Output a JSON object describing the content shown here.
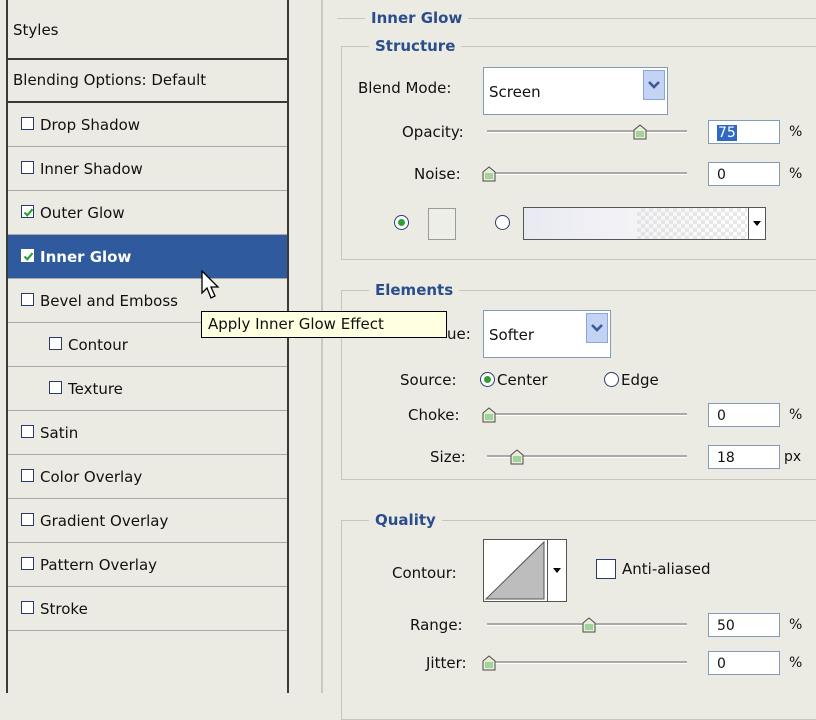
{
  "left_panel": {
    "styles_header": "Styles",
    "blending_header": "Blending Options: Default",
    "items": [
      {
        "label": "Drop Shadow",
        "checked": false
      },
      {
        "label": "Inner Shadow",
        "checked": false
      },
      {
        "label": "Outer Glow",
        "checked": true
      },
      {
        "label": "Inner Glow",
        "checked": true,
        "selected": true
      },
      {
        "label": "Bevel and Emboss",
        "checked": false
      },
      {
        "label": "Contour",
        "checked": false,
        "indent": true
      },
      {
        "label": "Texture",
        "checked": false,
        "indent": true
      },
      {
        "label": "Satin",
        "checked": false
      },
      {
        "label": "Color Overlay",
        "checked": false
      },
      {
        "label": "Gradient Overlay",
        "checked": false
      },
      {
        "label": "Pattern Overlay",
        "checked": false
      },
      {
        "label": "Stroke",
        "checked": false
      }
    ]
  },
  "tooltip": "Apply Inner Glow Effect",
  "inner_glow": {
    "title": "Inner Glow",
    "structure": {
      "title": "Structure",
      "blend_mode_label": "Blend Mode:",
      "blend_mode_value": "Screen",
      "opacity_label": "Opacity:",
      "opacity_value": "75",
      "opacity_unit": "%",
      "noise_label": "Noise:",
      "noise_value": "0",
      "noise_unit": "%",
      "color_radio_selected": "solid-color"
    },
    "elements": {
      "title": "Elements",
      "technique_label_visible": "ue:",
      "technique_value": "Softer",
      "source_label": "Source:",
      "source_center": "Center",
      "source_edge": "Edge",
      "source_selected": "Center",
      "choke_label": "Choke:",
      "choke_value": "0",
      "choke_unit": "%",
      "size_label": "Size:",
      "size_value": "18",
      "size_unit": "px"
    },
    "quality": {
      "title": "Quality",
      "contour_label": "Contour:",
      "anti_aliased_label": "Anti-aliased",
      "anti_aliased_checked": false,
      "range_label": "Range:",
      "range_value": "50",
      "range_unit": "%",
      "jitter_label": "Jitter:",
      "jitter_value": "0",
      "jitter_unit": "%"
    }
  },
  "colors": {
    "panel_bg": "#ecebe3",
    "selection_bg": "#2f5a9e",
    "section_title": "#2a4e8c",
    "checkmark": "#2da035",
    "tooltip_bg": "#ffffe1"
  }
}
